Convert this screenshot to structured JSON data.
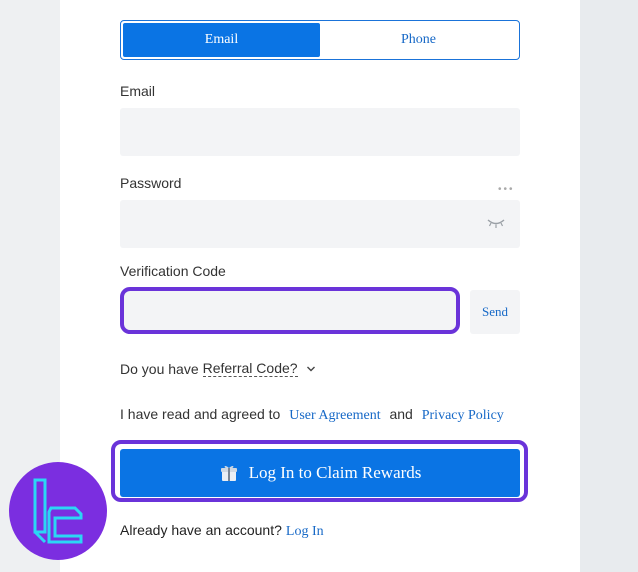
{
  "tabs": {
    "email": "Email",
    "phone": "Phone"
  },
  "email_label": "Email",
  "password_label": "Password",
  "password_dots": "•••",
  "verification_label": "Verification Code",
  "send_label": "Send",
  "referral": {
    "prefix": "Do you have",
    "link": "Referral Code?"
  },
  "agreement": {
    "text": "I have read and agreed to",
    "user_agreement": "User Agreement",
    "and": "and",
    "privacy_policy": "Privacy Policy"
  },
  "cta_label": "Log In to Claim Rewards",
  "account": {
    "text": "Already have an account?",
    "login": "Log In"
  },
  "colors": {
    "primary": "#0a74e4",
    "highlight": "#6a33d9",
    "link": "#1769c7",
    "logo_bg": "#7b2ee0",
    "logo_fg": "#2bd6f5"
  }
}
